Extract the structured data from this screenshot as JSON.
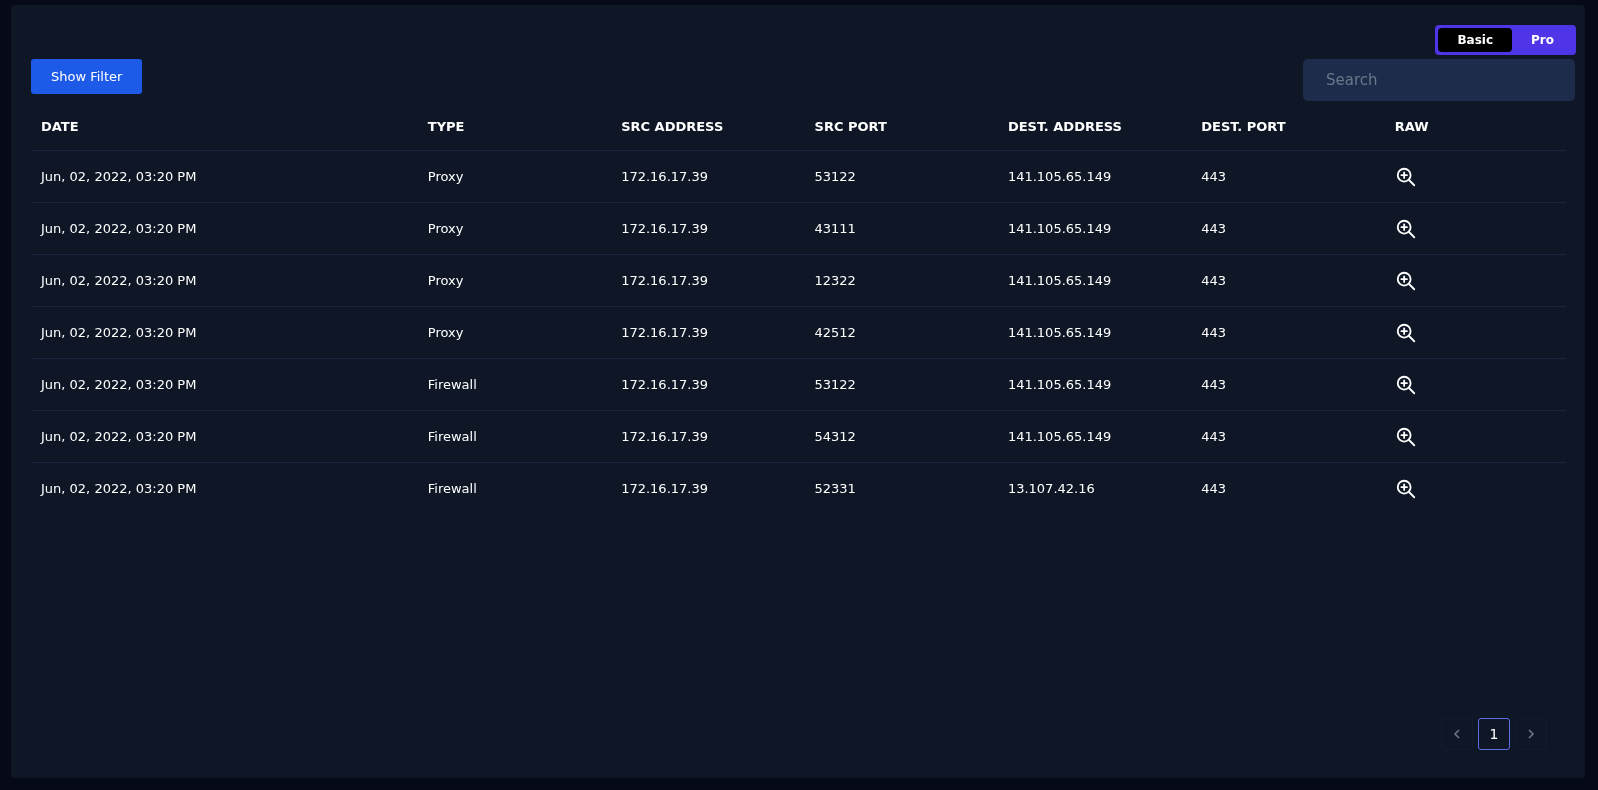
{
  "mode_toggle": [
    {
      "label": "Basic",
      "selected": true
    },
    {
      "label": "Pro",
      "selected": false
    }
  ],
  "filter_button": "Show Filter",
  "search": {
    "placeholder": "Search"
  },
  "table": {
    "columns": [
      "DATE",
      "TYPE",
      "SRC ADDRESS",
      "SRC PORT",
      "DEST. ADDRESS",
      "DEST. PORT",
      "RAW"
    ],
    "rows": [
      {
        "date": "Jun, 02, 2022, 03:20 PM",
        "type": "Proxy",
        "src_address": "172.16.17.39",
        "src_port": "53122",
        "dest_address": "141.105.65.149",
        "dest_port": "443"
      },
      {
        "date": "Jun, 02, 2022, 03:20 PM",
        "type": "Proxy",
        "src_address": "172.16.17.39",
        "src_port": "43111",
        "dest_address": "141.105.65.149",
        "dest_port": "443"
      },
      {
        "date": "Jun, 02, 2022, 03:20 PM",
        "type": "Proxy",
        "src_address": "172.16.17.39",
        "src_port": "12322",
        "dest_address": "141.105.65.149",
        "dest_port": "443"
      },
      {
        "date": "Jun, 02, 2022, 03:20 PM",
        "type": "Proxy",
        "src_address": "172.16.17.39",
        "src_port": "42512",
        "dest_address": "141.105.65.149",
        "dest_port": "443"
      },
      {
        "date": "Jun, 02, 2022, 03:20 PM",
        "type": "Firewall",
        "src_address": "172.16.17.39",
        "src_port": "53122",
        "dest_address": "141.105.65.149",
        "dest_port": "443"
      },
      {
        "date": "Jun, 02, 2022, 03:20 PM",
        "type": "Firewall",
        "src_address": "172.16.17.39",
        "src_port": "54312",
        "dest_address": "141.105.65.149",
        "dest_port": "443"
      },
      {
        "date": "Jun, 02, 2022, 03:20 PM",
        "type": "Firewall",
        "src_address": "172.16.17.39",
        "src_port": "52331",
        "dest_address": "13.107.42.16",
        "dest_port": "443"
      }
    ]
  },
  "pagination": {
    "pages": [
      {
        "label": "1",
        "selected": true
      }
    ]
  }
}
